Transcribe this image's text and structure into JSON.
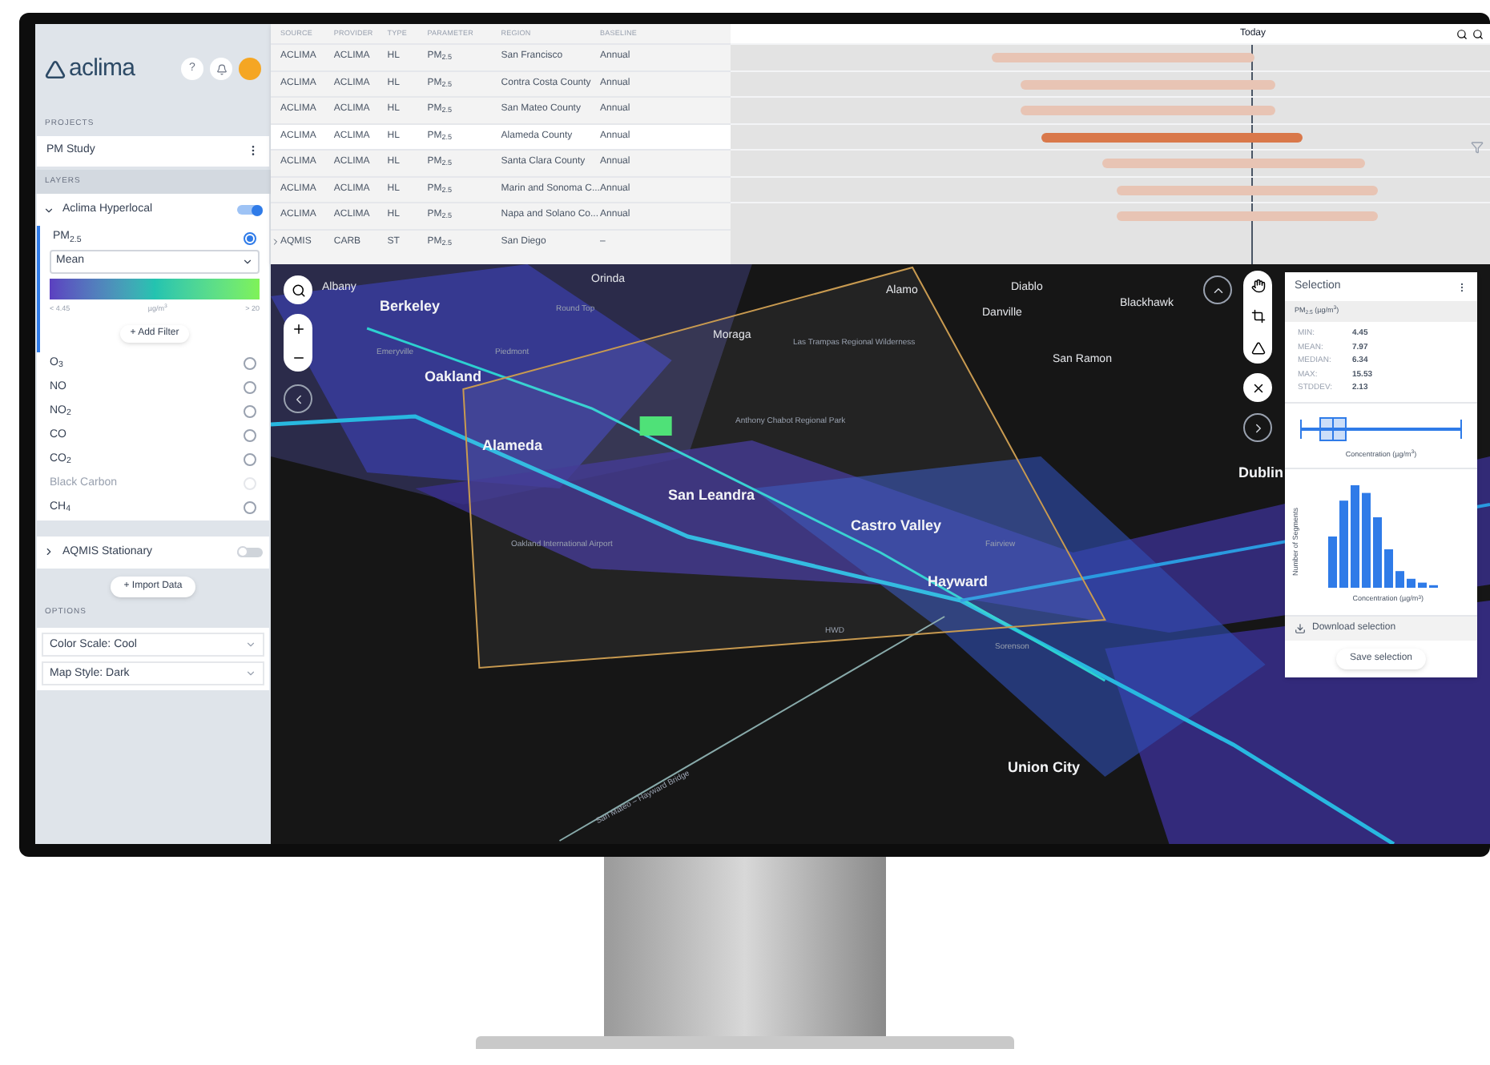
{
  "sidebar": {
    "logo": "aclima",
    "help_button": "?",
    "projects_header": "PROJECTS",
    "project": "PM Study",
    "layers_header": "LAYERS",
    "layers": [
      {
        "name": "Aclima Hyperlocal",
        "expanded": true,
        "on": true,
        "statistic": "Mean",
        "scale_min": "< 4.45",
        "scale_unit": "µg/m$^{3}$",
        "scale_max": "> 20",
        "add_filter": "+ Add Filter",
        "parameters": [
          {
            "label": "PM$_{2.5}$",
            "selected": true,
            "disabled": false
          },
          {
            "label": "O$_{3}$",
            "selected": false,
            "disabled": false
          },
          {
            "label": "NO",
            "selected": false,
            "disabled": false
          },
          {
            "label": "NO$_{2}$",
            "selected": false,
            "disabled": false
          },
          {
            "label": "CO",
            "selected": false,
            "disabled": false
          },
          {
            "label": "CO$_{2}$",
            "selected": false,
            "disabled": false
          },
          {
            "label": "Black Carbon",
            "selected": false,
            "disabled": true
          },
          {
            "label": "CH$_{4}$",
            "selected": false,
            "disabled": false
          }
        ]
      },
      {
        "name": "AQMIS Stationary",
        "expanded": false,
        "on": false
      }
    ],
    "import_button": "+ Import Data",
    "options_header": "OPTIONS",
    "options": [
      "Color Scale: Cool",
      "Map Style: Dark"
    ]
  },
  "table": {
    "columns": [
      "SOURCE",
      "PROVIDER",
      "TYPE",
      "PARAMETER",
      "REGION",
      "BASELINE"
    ],
    "rows": [
      {
        "kind": "row",
        "selected": false,
        "cells": [
          "ACLIMA",
          "ACLIMA",
          "HL",
          "PM$_{2.5}$",
          "San Francisco",
          "Annual"
        ]
      },
      {
        "kind": "row",
        "selected": false,
        "cells": [
          "ACLIMA",
          "ACLIMA",
          "HL",
          "PM$_{2.5}$",
          "Contra Costa County",
          "Annual"
        ]
      },
      {
        "kind": "row",
        "selected": false,
        "cells": [
          "ACLIMA",
          "ACLIMA",
          "HL",
          "PM$_{2.5}$",
          "San Mateo County",
          "Annual"
        ]
      },
      {
        "kind": "row",
        "selected": true,
        "cells": [
          "ACLIMA",
          "ACLIMA",
          "HL",
          "PM$_{2.5}$",
          "Alameda County",
          "Annual"
        ]
      },
      {
        "kind": "row",
        "selected": false,
        "cells": [
          "ACLIMA",
          "ACLIMA",
          "HL",
          "PM$_{2.5}$",
          "Santa Clara County",
          "Annual"
        ]
      },
      {
        "kind": "row",
        "selected": false,
        "cells": [
          "ACLIMA",
          "ACLIMA",
          "HL",
          "PM$_{2.5}$",
          "Marin and Sonoma C...",
          "Annual"
        ]
      },
      {
        "kind": "row",
        "selected": false,
        "cells": [
          "ACLIMA",
          "ACLIMA",
          "HL",
          "PM$_{2.5}$",
          "Napa and Solano Co...",
          "Annual"
        ]
      },
      {
        "kind": "group",
        "selected": false,
        "cells": [
          "AQMIS",
          "CARB",
          "ST",
          "PM$_{2.5}$",
          "San Diego",
          "–"
        ]
      }
    ]
  },
  "timeline": {
    "today": "Today"
  },
  "map": {
    "labels": [
      {
        "text": "Albany",
        "kind": "town"
      },
      {
        "text": "Berkeley",
        "kind": "city"
      },
      {
        "text": "Orinda",
        "kind": "town"
      },
      {
        "text": "Moraga",
        "kind": "town"
      },
      {
        "text": "Alamo",
        "kind": "town"
      },
      {
        "text": "Diablo",
        "kind": "town"
      },
      {
        "text": "Danville",
        "kind": "town"
      },
      {
        "text": "Blackhawk",
        "kind": "town"
      },
      {
        "text": "San Ramon",
        "kind": "town"
      },
      {
        "text": "Oakland",
        "kind": "city"
      },
      {
        "text": "Alameda",
        "kind": "city"
      },
      {
        "text": "San Leandra",
        "kind": "city"
      },
      {
        "text": "Castro Valley",
        "kind": "city"
      },
      {
        "text": "Hayward",
        "kind": "city"
      },
      {
        "text": "Dublin",
        "kind": "city"
      },
      {
        "text": "Union City",
        "kind": "city"
      },
      {
        "text": "Oakland International Airport",
        "kind": "place"
      },
      {
        "text": "HWD",
        "kind": "place"
      },
      {
        "text": "Round Top",
        "kind": "place"
      },
      {
        "text": "Piedmont",
        "kind": "place"
      },
      {
        "text": "Emeryville",
        "kind": "place"
      },
      {
        "text": "Anthony Chabot Regional Park",
        "kind": "place"
      },
      {
        "text": "Las Trampas Regional Wilderness",
        "kind": "place"
      },
      {
        "text": "Fairview",
        "kind": "place"
      },
      {
        "text": "Sorenson",
        "kind": "place"
      },
      {
        "text": "San Mateo – Hayward Bridge",
        "kind": "place"
      }
    ]
  },
  "selection": {
    "title": "Selection",
    "parameter": "PM$_{2.5}$ (µg/m$^{3}$)",
    "stats": [
      {
        "label": "MIN:",
        "value": "4.45"
      },
      {
        "label": "MEAN:",
        "value": "7.97"
      },
      {
        "label": "MEDIAN:",
        "value": "6.34"
      },
      {
        "label": "MAX:",
        "value": "15.53"
      },
      {
        "label": "STDDEV:",
        "value": "2.13"
      }
    ],
    "boxplot_xlabel": "Concentration (µg/m$^{3}$)",
    "histogram_xlabel": "Concentration (µg/m$^{3}$)",
    "histogram_ylabel": "Number of Segments",
    "download": "Download selection",
    "save": "Save selection"
  }
}
